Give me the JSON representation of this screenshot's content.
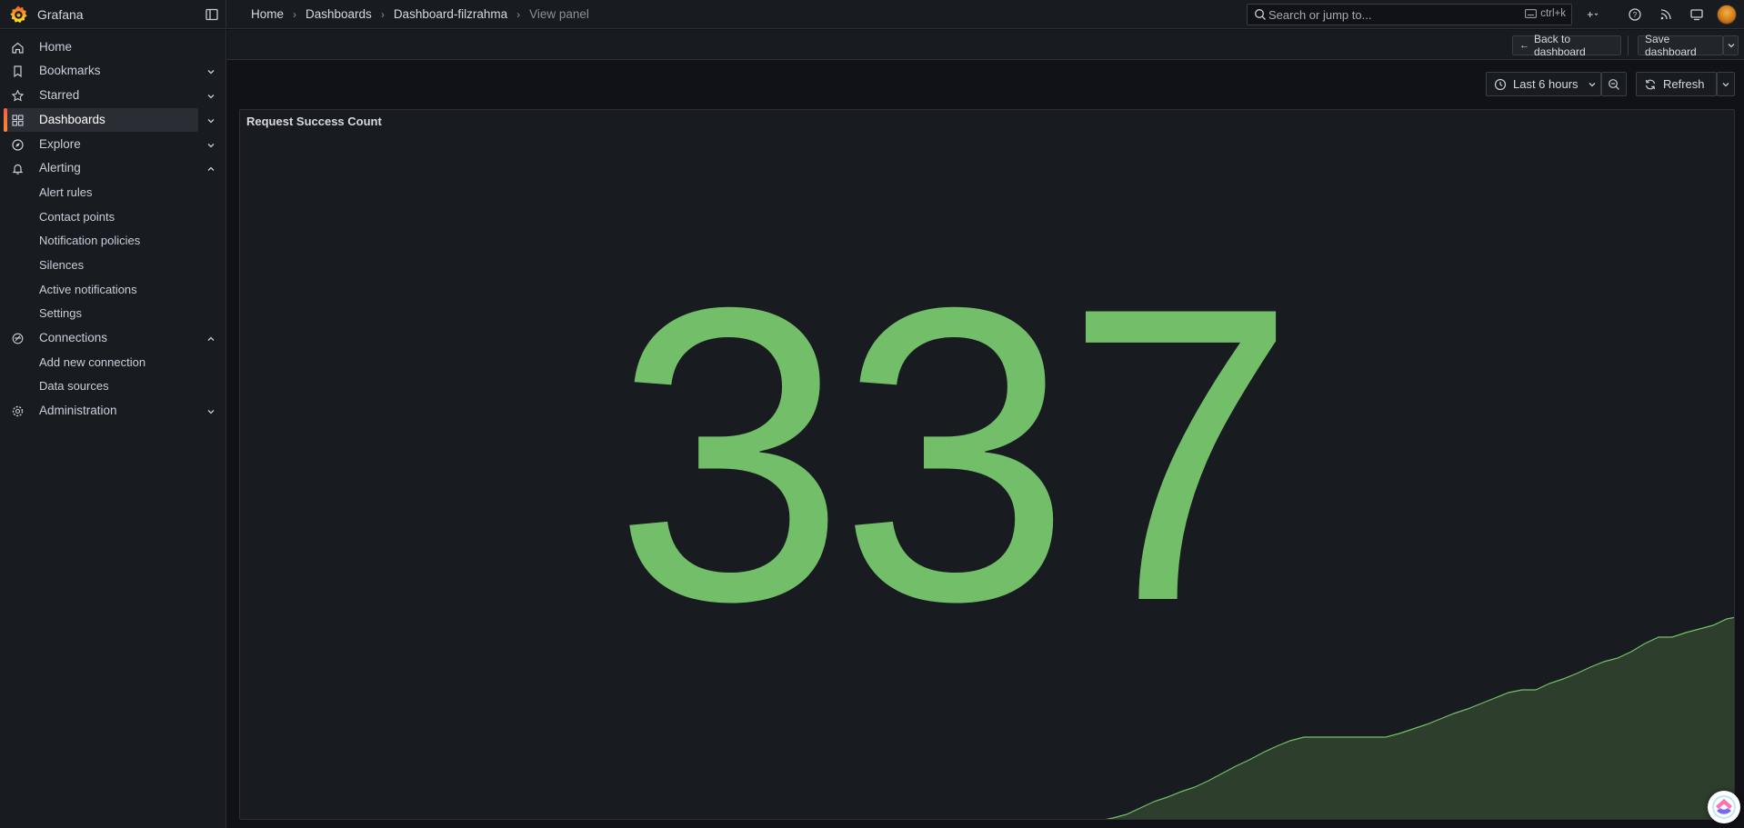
{
  "app": {
    "name": "Grafana"
  },
  "breadcrumb": [
    "Home",
    "Dashboards",
    "Dashboard-filzrahma",
    "View panel"
  ],
  "search": {
    "placeholder": "Search or jump to...",
    "shortcut": "ctrl+k"
  },
  "sidebar": {
    "items": [
      {
        "label": "Home",
        "icon": "home-icon"
      },
      {
        "label": "Bookmarks",
        "icon": "bookmark-icon"
      },
      {
        "label": "Starred",
        "icon": "star-icon"
      },
      {
        "label": "Dashboards",
        "icon": "dashboards-icon",
        "active": true
      },
      {
        "label": "Explore",
        "icon": "compass-icon"
      },
      {
        "label": "Alerting",
        "icon": "bell-icon",
        "expanded": true,
        "children": [
          "Alert rules",
          "Contact points",
          "Notification policies",
          "Silences",
          "Active notifications",
          "Settings"
        ]
      },
      {
        "label": "Connections",
        "icon": "connections-icon",
        "expanded": true,
        "children": [
          "Add new connection",
          "Data sources"
        ]
      },
      {
        "label": "Administration",
        "icon": "gear-icon"
      }
    ]
  },
  "toolbar": {
    "back_label": "Back to dashboard",
    "save_label": "Save dashboard",
    "time_range": "Last 6 hours",
    "refresh_label": "Refresh"
  },
  "panel": {
    "title": "Request Success Count",
    "value": "337",
    "value_color": "#73bf69"
  },
  "colors": {
    "accent": "#f55f3e",
    "stat_green": "#73bf69",
    "spark_fill": "#2e3e2c"
  }
}
